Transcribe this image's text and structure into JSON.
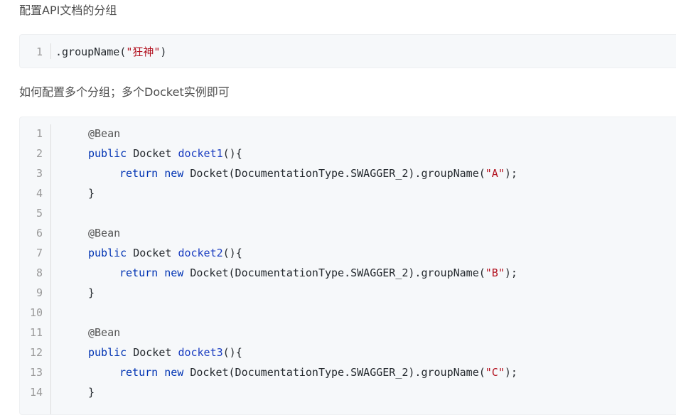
{
  "paragraph1": "配置API文档的分组",
  "snippet1": {
    "line_number": "1",
    "prefix": ".groupName(",
    "string": "\"狂神\"",
    "suffix": ")"
  },
  "paragraph2": "如何配置多个分组；多个Docket实例即可",
  "snippet2": {
    "line_numbers": [
      "1",
      "2",
      "3",
      "4",
      "5",
      "6",
      "7",
      "8",
      "9",
      "10",
      "11",
      "12",
      "13",
      "14"
    ],
    "annotation": "@Bean",
    "kw_public": "public",
    "type": "Docket",
    "paren_brace": "(){",
    "kw_return": "return",
    "kw_new": "new",
    "ctor_text": "Docket(DocumentationType.SWAGGER_2).groupName(",
    "close": ");",
    "rbrace": "}",
    "methods": [
      {
        "name": "docket1",
        "group": "\"A\""
      },
      {
        "name": "docket2",
        "group": "\"B\""
      },
      {
        "name": "docket3",
        "group": "\"C\""
      }
    ]
  }
}
